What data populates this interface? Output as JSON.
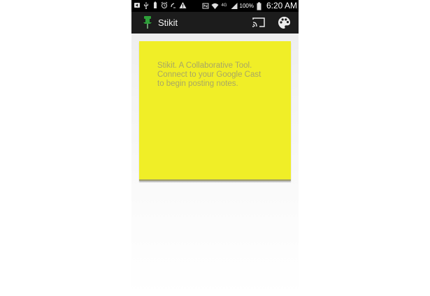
{
  "status_bar": {
    "left_icons": [
      "back-arrow-icon",
      "usb-icon",
      "battery-small-icon",
      "alarm-icon",
      "wifi-calling-icon",
      "warning-icon"
    ],
    "battery_percent": "100%",
    "time": "6:20 AM",
    "network_label": "4G"
  },
  "app_bar": {
    "title": "Stikit",
    "actions": [
      "cast-icon",
      "palette-icon"
    ]
  },
  "note": {
    "text": "Stikit. A Collaborative Tool.\nConnect to your Google Cast\nto begin posting notes.",
    "color": "#f0ee27"
  },
  "colors": {
    "status_bar": "#000000",
    "app_bar": "#1c1c1c",
    "note": "#f0ee27",
    "pin": "#2ea13a"
  }
}
